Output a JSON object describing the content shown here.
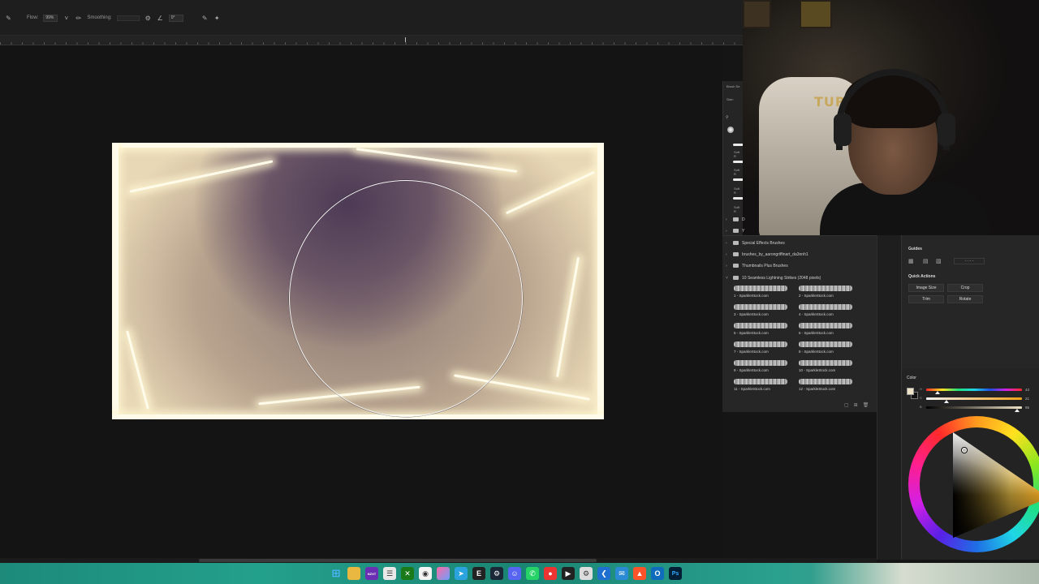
{
  "options_bar": {
    "flow_label": "Flow:",
    "flow_value": "99%",
    "smoothing_label": "Smoothing:",
    "angle_value": "0°"
  },
  "brush_settings": {
    "title": "Brush Se",
    "size_label": "Size:",
    "stroke_labels": [
      "Soft R",
      "Soft R",
      "Soft R",
      "Soft R"
    ]
  },
  "brushes_panel": {
    "folders": [
      {
        "label": "D",
        "expanded": false
      },
      {
        "label": "Y",
        "expanded": false
      },
      {
        "label": "Special Effects Brushes",
        "expanded": false
      },
      {
        "label": "brushes_by_aarongriffinart_da3nnh1",
        "expanded": false
      },
      {
        "label": "Thumbnails Plus Brushes",
        "expanded": false
      },
      {
        "label": "10 Seamless Lightning Strikes (2048 pixels)",
        "expanded": true
      }
    ],
    "brushes": [
      "1 - SparkleStock.com",
      "2 - SparkleStock.com",
      "3 - SparkleStock.com",
      "4 - SparkleStock.com",
      "5 - SparkleStock.com",
      "6 - SparkleStock.com",
      "7 - SparkleStock.com",
      "8 - SparkleStock.com",
      "9 - SparkleStock.com",
      "10 - SparkleStock.com",
      "11 - SparkleStock.com",
      "12 - SparkleStock.com"
    ]
  },
  "properties": {
    "guides_heading": "Guides",
    "guides_dropdown": "- - - -",
    "quick_actions_heading": "Quick Actions",
    "buttons": {
      "image_size": "Image Size",
      "crop": "Crop",
      "trim": "Trim",
      "rotate": "Rotate"
    }
  },
  "color_panel": {
    "title": "Color",
    "sliders": [
      {
        "label": "H",
        "value": "43",
        "fraction": 0.12
      },
      {
        "label": "S",
        "value": "21",
        "fraction": 0.21
      },
      {
        "label": "B",
        "value": "95",
        "fraction": 0.95
      }
    ],
    "foreground": "#efe3c7",
    "background": "#111111"
  },
  "webcam": {
    "chair_text": "TUR"
  },
  "taskbar": {
    "icons": [
      "windows-icon",
      "file-explorer-icon",
      "nzxt-icon",
      "notepad-icon",
      "xbox-icon",
      "chrome-icon",
      "photos-icon",
      "telegram-icon",
      "epic-icon",
      "steam-icon",
      "discord-icon",
      "whatsapp-icon",
      "browser-icon",
      "media-icon",
      "settings-icon",
      "vscode-icon",
      "mail-icon",
      "brave-icon",
      "outlook-icon",
      "photoshop-icon"
    ],
    "nzxt_label": "NZXT",
    "photoshop_label": "Ps"
  },
  "colors": {
    "canvas_bg": "#141414",
    "panel_bg": "#262626",
    "accent_taskbar": "#1d8a7a"
  }
}
